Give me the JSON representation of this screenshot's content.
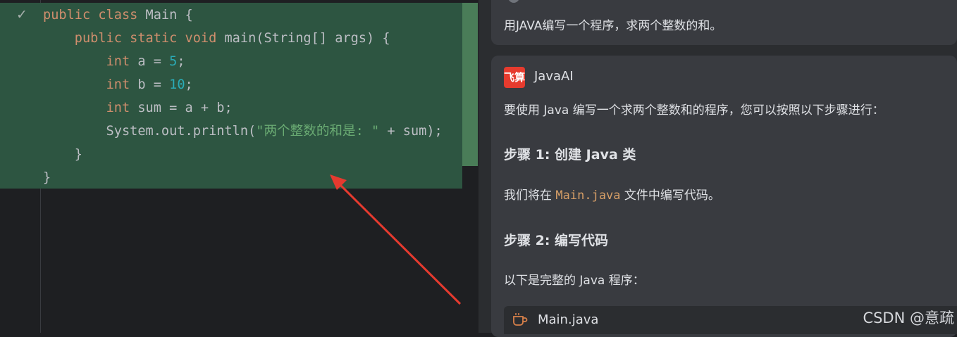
{
  "editor": {
    "check": "✓",
    "code": [
      "public class Main {",
      "    public static void main(String[] args) {",
      "        int a = 5;",
      "        int b = 10;",
      "        int sum = a + b;",
      "        System.out.println(\"两个整数的和是: \" + sum);",
      "    }",
      "}"
    ]
  },
  "chat": {
    "question": "用JAVA编写一个程序，求两个整数的和。",
    "logo_text": "飞算",
    "brand": "JavaAI",
    "intro": "要使用 Java 编写一个求两个整数和的程序，您可以按照以下步骤进行：",
    "step1_title": "步骤 1: 创建 Java 类",
    "step1_pre": "我们将在 ",
    "step1_code": "Main.java",
    "step1_post": " 文件中编写代码。",
    "step2_title": "步骤 2: 编写代码",
    "step2_text": "以下是完整的 Java 程序：",
    "file_name": "Main.java"
  },
  "watermark": "CSDN @意疏",
  "colors": {
    "keyword": "#cf8e6d",
    "number": "#2aacb8",
    "string": "#6aab73",
    "diff_bg": "#2d5541",
    "arrow": "#e53a2f"
  }
}
